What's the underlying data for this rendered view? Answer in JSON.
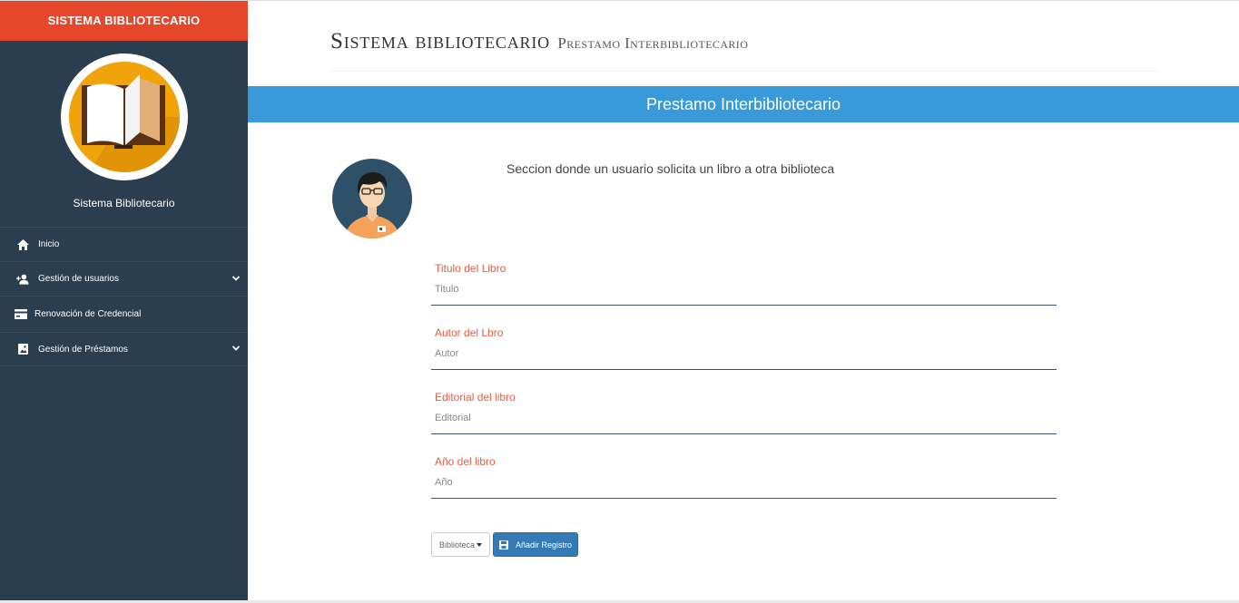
{
  "sidebar": {
    "brand": "SISTEMA BIBLIOTECARIO",
    "app_name": "Sistema Bibliotecario",
    "items": [
      {
        "label": "Inicio",
        "icon": "home-icon"
      },
      {
        "label": "Gestión de usuarios",
        "icon": "user-plus-icon",
        "expandable": true
      },
      {
        "label": "Renovación de Credencial",
        "icon": "credit-card-icon"
      },
      {
        "label": "Gestión de Préstamos",
        "icon": "image-icon",
        "expandable": true
      }
    ]
  },
  "header": {
    "title": "Sistema bibliotecario",
    "subtitle": "Prestamo Interbibliotecario"
  },
  "banner": {
    "title": "Prestamo Interbibliotecario"
  },
  "intro": {
    "text": "Seccion donde un usuario solicita un libro a otra biblioteca"
  },
  "form": {
    "fields": [
      {
        "label": "Titulo del Libro",
        "placeholder": "Titulo"
      },
      {
        "label": "Autor del Lbro",
        "placeholder": "Autor"
      },
      {
        "label": "Editorial del libro",
        "placeholder": "Editorial"
      },
      {
        "label": "Año del libro",
        "placeholder": "Año"
      }
    ],
    "dropdown_label": "Biblioteca",
    "submit_label": "Añadir Registro"
  },
  "colors": {
    "sidebar_bg": "#2b3e50",
    "brand_bg": "#e6472a",
    "banner_bg": "#3a9ad9",
    "label_color": "#e35d43",
    "button_primary": "#337ab7"
  }
}
